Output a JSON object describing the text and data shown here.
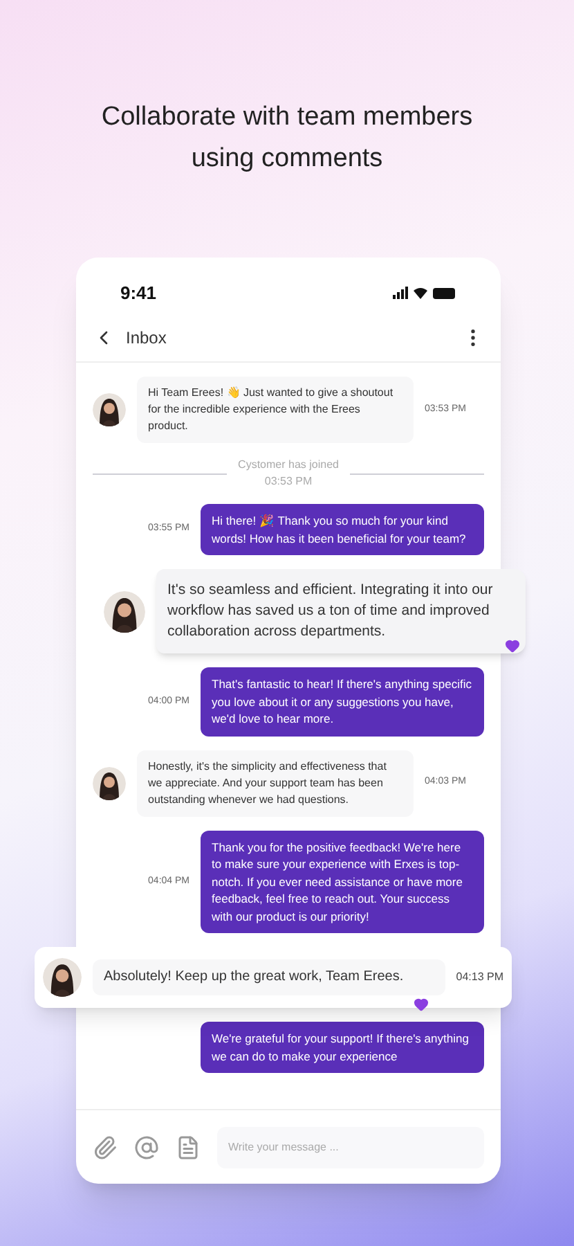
{
  "headline": "Collaborate with team members using comments",
  "status_bar": {
    "time": "9:41"
  },
  "header": {
    "title": "Inbox"
  },
  "messages": [
    {
      "kind": "incoming",
      "text": "Hi Team Erees! 👋 Just wanted to give a shoutout for the incredible experience with the Erees product.",
      "time": "03:53 PM",
      "reacted": false
    },
    {
      "kind": "system",
      "text": "Cystomer has joined",
      "time": "03:53 PM"
    },
    {
      "kind": "outgoing",
      "text": "Hi there! 🎉 Thank you so much for your kind words! How has it been beneficial for your team?",
      "time": "03:55 PM"
    },
    {
      "kind": "featured",
      "text": "It's so seamless and efficient. Integrating it into our workflow has saved us a ton of time and improved collaboration across departments.",
      "reacted": true
    },
    {
      "kind": "outgoing",
      "text": "That's fantastic to hear! If there's anything specific you love about it or any suggestions you have, we'd love to hear more.",
      "time": "04:00 PM"
    },
    {
      "kind": "incoming",
      "text": "Honestly, it's the simplicity and effectiveness that we appreciate. And your support team has been outstanding whenever we had questions.",
      "time": "04:03 PM",
      "reacted": false
    },
    {
      "kind": "outgoing",
      "text": "Thank you for the positive feedback! We're here to make sure your experience with Erxes is top-notch. If you ever need assistance or have more feedback, feel free to reach out. Your success with our product is our priority!",
      "time": "04:04 PM"
    },
    {
      "kind": "highlight",
      "text": "Absolutely! Keep up the great work, Team Erees.",
      "time": "04:13 PM",
      "reacted": true
    },
    {
      "kind": "outgoing",
      "text": "We're grateful for your support! If there's anything we can do to make your experience"
    }
  ],
  "composer": {
    "placeholder": "Write your message ..."
  }
}
